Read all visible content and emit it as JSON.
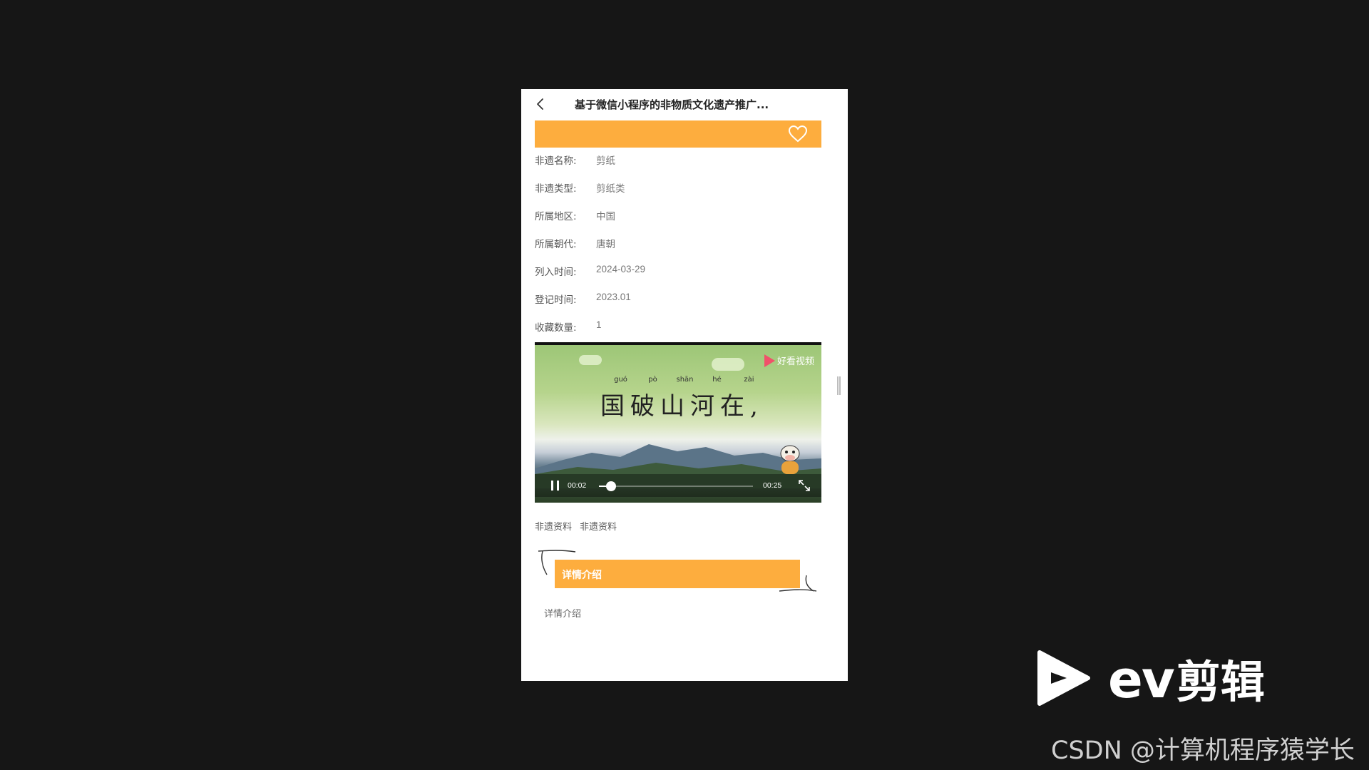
{
  "navbar": {
    "title": "基于微信小程序的非物质文化遗产推广..."
  },
  "icons": {
    "back": "chevron-left-icon",
    "favorite": "heart-outline-icon",
    "pause": "pause-icon",
    "fullscreen": "fullscreen-icon"
  },
  "colors": {
    "accent": "#fdad3e",
    "background": "#161616",
    "page": "#ffffff"
  },
  "info": {
    "items": [
      {
        "label": "非遗名称:",
        "value": "剪纸"
      },
      {
        "label": "非遗类型:",
        "value": "剪纸类"
      },
      {
        "label": "所属地区:",
        "value": "中国"
      },
      {
        "label": "所属朝代:",
        "value": "唐朝"
      },
      {
        "label": "列入时间:",
        "value": "2024-03-29"
      },
      {
        "label": "登记时间:",
        "value": "2023.01"
      },
      {
        "label": "收藏数量:",
        "value": "1"
      }
    ]
  },
  "video": {
    "brand": "好看视频",
    "pinyin": [
      "guó",
      "pò",
      "shān",
      "hé",
      "zài"
    ],
    "poem": "国破山河在,",
    "current_time": "00:02",
    "duration": "00:25",
    "progress_fraction": 0.08
  },
  "tags": [
    "非遗资料",
    "非遗资料"
  ],
  "detail": {
    "header": "详情介绍",
    "body": "详情介绍"
  },
  "watermark": {
    "ev_latin": "ev",
    "ev_cn": "剪辑",
    "csdn": "CSDN @计算机程序猿学长"
  }
}
